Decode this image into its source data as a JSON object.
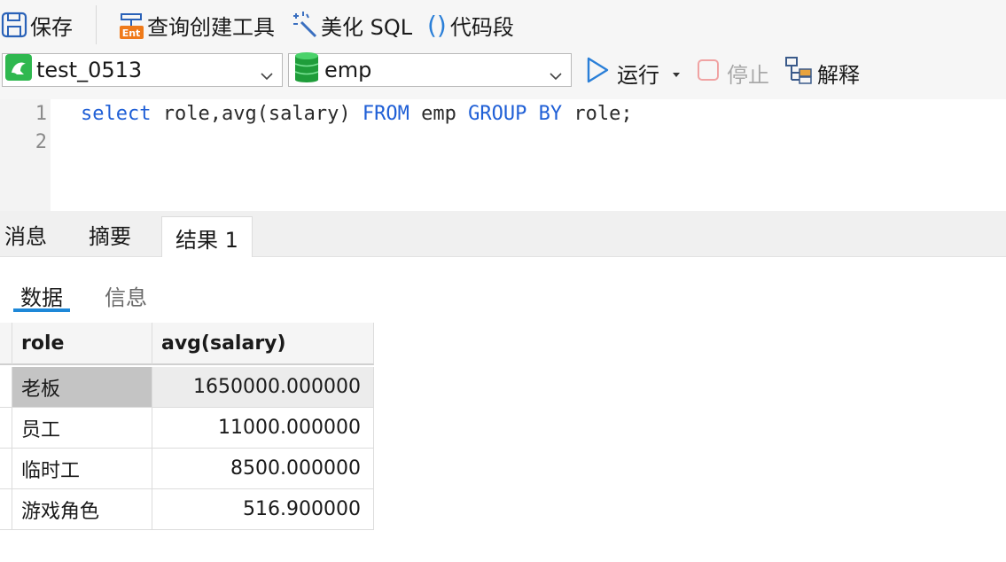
{
  "toolbar": {
    "save_label": "保存",
    "query_builder_label": "查询创建工具",
    "beautify_label": "美化 SQL",
    "snippet_label": "代码段",
    "snippet_icon": "()"
  },
  "connection": {
    "selected": "test_0513",
    "database": "emp"
  },
  "actions": {
    "run_label": "运行",
    "stop_label": "停止",
    "explain_label": "解释"
  },
  "editor": {
    "line_numbers": [
      "1",
      "2"
    ],
    "tokens": [
      {
        "text": "select",
        "kw": true
      },
      {
        "text": " role,avg(salary) ",
        "kw": false
      },
      {
        "text": "FROM",
        "kw": true
      },
      {
        "text": " emp ",
        "kw": false
      },
      {
        "text": "GROUP BY",
        "kw": true
      },
      {
        "text": " role;",
        "kw": false
      }
    ]
  },
  "result_tabs": {
    "messages": "消息",
    "summary": "摘要",
    "result": "结果 1"
  },
  "sub_tabs": {
    "data": "数据",
    "info": "信息"
  },
  "table": {
    "columns": [
      "role",
      "avg(salary)"
    ],
    "rows": [
      [
        "老板",
        "1650000.000000"
      ],
      [
        "员工",
        "11000.000000"
      ],
      [
        "临时工",
        "8500.000000"
      ],
      [
        "游戏角色",
        "516.900000"
      ]
    ]
  },
  "colors": {
    "keyword": "#1f5fd6",
    "accent": "#1e88d8",
    "connection_icon": "#2fb84f",
    "database_icon": "#1f9d3a"
  }
}
